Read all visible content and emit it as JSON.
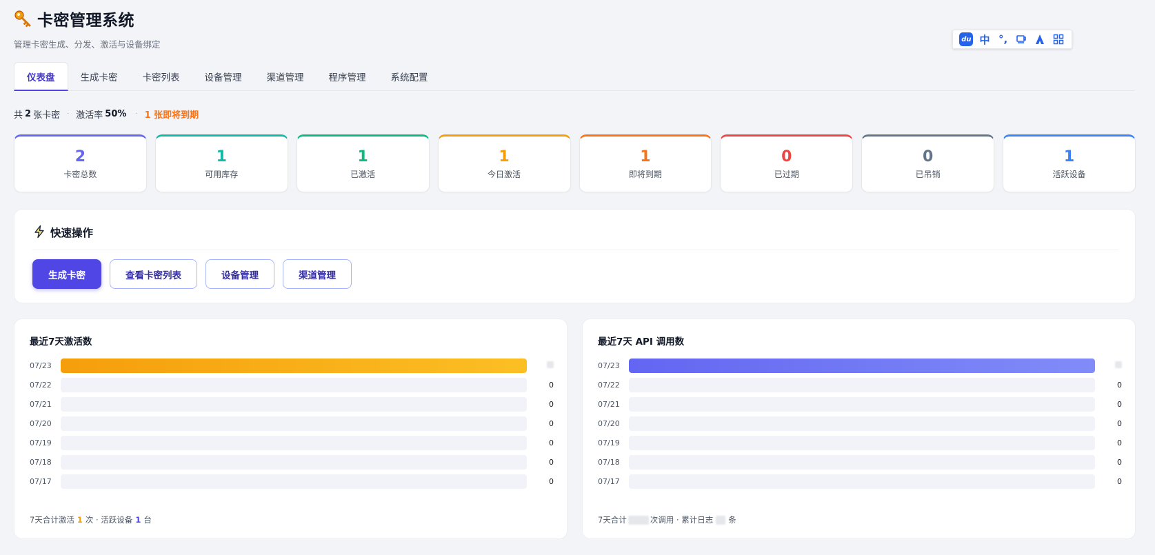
{
  "app": {
    "title": "卡密管理系统",
    "subtitle": "管理卡密生成、分发、激活与设备绑定"
  },
  "ime": {
    "logo": "du",
    "lang": "中",
    "punct": "°,"
  },
  "tabs": [
    {
      "label": "仪表盘",
      "active": true
    },
    {
      "label": "生成卡密"
    },
    {
      "label": "卡密列表"
    },
    {
      "label": "设备管理"
    },
    {
      "label": "渠道管理"
    },
    {
      "label": "程序管理"
    },
    {
      "label": "系统配置"
    }
  ],
  "summary": {
    "prefix": "共",
    "total": "2",
    "total_suffix": "张卡密",
    "rate_label": "激活率",
    "rate": "50%",
    "expiring": "1 张即将到期"
  },
  "stats": [
    {
      "value": "2",
      "label": "卡密总数",
      "color": "#6366f1"
    },
    {
      "value": "1",
      "label": "可用库存",
      "color": "#14b8a6"
    },
    {
      "value": "1",
      "label": "已激活",
      "color": "#10b981"
    },
    {
      "value": "1",
      "label": "今日激活",
      "color": "#f59e0b"
    },
    {
      "value": "1",
      "label": "即将到期",
      "color": "#f97316"
    },
    {
      "value": "0",
      "label": "已过期",
      "color": "#ef4444"
    },
    {
      "value": "0",
      "label": "已吊销",
      "color": "#64748b"
    },
    {
      "value": "1",
      "label": "活跃设备",
      "color": "#3b82f6"
    }
  ],
  "quick": {
    "title": "快速操作",
    "buttons": [
      "生成卡密",
      "查看卡密列表",
      "设备管理",
      "渠道管理"
    ]
  },
  "activations": {
    "title": "最近7天激活数",
    "rows": [
      {
        "date": "07/23",
        "value": "",
        "fill": 1.0
      },
      {
        "date": "07/22",
        "value": "0",
        "fill": 0
      },
      {
        "date": "07/21",
        "value": "0",
        "fill": 0
      },
      {
        "date": "07/20",
        "value": "0",
        "fill": 0
      },
      {
        "date": "07/19",
        "value": "0",
        "fill": 0
      },
      {
        "date": "07/18",
        "value": "0",
        "fill": 0
      },
      {
        "date": "07/17",
        "value": "0",
        "fill": 0
      }
    ],
    "footer": {
      "prefix": "7天合计激活",
      "count": "1",
      "mid": "次 · 活跃设备",
      "devices": "1",
      "suffix": "台"
    }
  },
  "api_calls": {
    "title": "最近7天 API 调用数",
    "rows": [
      {
        "date": "07/23",
        "value": "",
        "fill": 1.0
      },
      {
        "date": "07/22",
        "value": "0",
        "fill": 0
      },
      {
        "date": "07/21",
        "value": "0",
        "fill": 0
      },
      {
        "date": "07/20",
        "value": "0",
        "fill": 0
      },
      {
        "date": "07/19",
        "value": "0",
        "fill": 0
      },
      {
        "date": "07/18",
        "value": "0",
        "fill": 0
      },
      {
        "date": "07/17",
        "value": "0",
        "fill": 0
      }
    ],
    "footer": {
      "prefix": "7天合计",
      "mid": "次调用 · 累计日志",
      "suffix": "条"
    }
  }
}
